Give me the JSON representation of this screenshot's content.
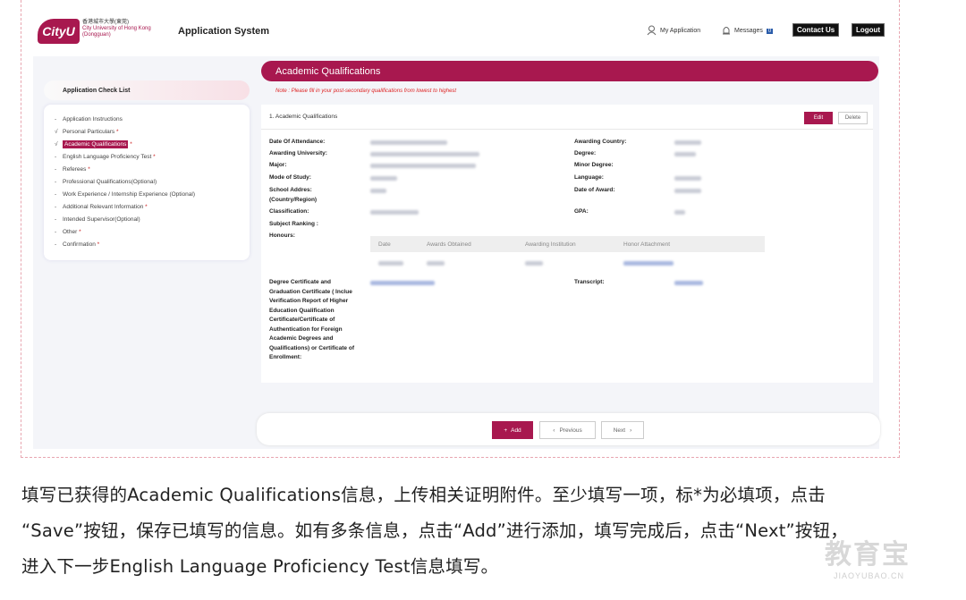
{
  "header": {
    "logo_text": "CityU",
    "university_zh": "香港城市大學(東莞)",
    "university_en": "City University of Hong Kong",
    "university_en2": "(Dongguan)",
    "app_title": "Application System",
    "my_application": "My Application",
    "messages": "Messages",
    "messages_count": "0",
    "contact_us": "Contact Us",
    "logout": "Logout"
  },
  "sidebar": {
    "title": "Application Check List",
    "items": [
      {
        "mark": "-",
        "label": "Application Instructions",
        "req": ""
      },
      {
        "mark": "√",
        "label": "Personal Particulars",
        "req": "*"
      },
      {
        "mark": "√",
        "label": "Academic Qualifications",
        "req": "*"
      },
      {
        "mark": "-",
        "label": "English Language Proficiency Test",
        "req": "*"
      },
      {
        "mark": "-",
        "label": "Referees",
        "req": "*"
      },
      {
        "mark": "-",
        "label": "Professional Qualifications(Optional)",
        "req": ""
      },
      {
        "mark": "-",
        "label": "Work Experience / Internship Experience (Optional)",
        "req": ""
      },
      {
        "mark": "-",
        "label": "Additional Relevant Information",
        "req": "*"
      },
      {
        "mark": "-",
        "label": "Intended Supervisor(Optional)",
        "req": ""
      },
      {
        "mark": "-",
        "label": "Other",
        "req": "*"
      },
      {
        "mark": "-",
        "label": "Confirmation",
        "req": "*"
      }
    ]
  },
  "main": {
    "title": "Academic Qualifications",
    "note": "Note : Please fill in your post-secondary qualifications from lowest to highest",
    "card_title": "1. Academic Qualifications",
    "edit": "Edit",
    "delete": "Delete",
    "labels_left": {
      "date_of_attendance": "Date Of Attendance:",
      "awarding_university": "Awarding University:",
      "major": "Major:",
      "mode_of_study": "Mode of Study:",
      "school_address": "School Addres: (Country/Region)",
      "classification": "Classification:",
      "subject_ranking": "Subject Ranking :",
      "honours": "Honours:",
      "degree_certificate": "Degree Certificate and Graduation Certificate ( Inclue Verification Report of Higher Education Qualification Certificate/Certificate of Authentication for Foreign Academic Degrees and Qualifications) or Certificate of Enrollment:"
    },
    "labels_right": {
      "awarding_country": "Awarding Country:",
      "degree": "Degree:",
      "minor_degree": "Minor Degree:",
      "language": "Language:",
      "date_of_award": "Date of Award:",
      "gpa": "GPA:",
      "transcript": "Transcript:"
    },
    "honor_table": {
      "columns": [
        "Date",
        "Awards Obtained",
        "Awarding Institution",
        "Honor Attachment"
      ]
    }
  },
  "footer": {
    "add": "Add",
    "previous": "Previous",
    "next": "Next"
  },
  "caption": {
    "line1": "填写已获得的Academic Qualifications信息，上传相关证明附件。至少填写一项，标*为必填项，点击",
    "line2": "“Save”按钮，保存已填写的信息。如有多条信息，点击“Add”进行添加，填写完成后，点击“Next”按钮，",
    "line3": "进入下一步English Language Proficiency Test信息填写。"
  },
  "watermark": {
    "zh": "教育宝",
    "en": "JIAOYUBAO.CN"
  },
  "colors": {
    "brand": "#a8184f",
    "note": "#dd2222"
  }
}
